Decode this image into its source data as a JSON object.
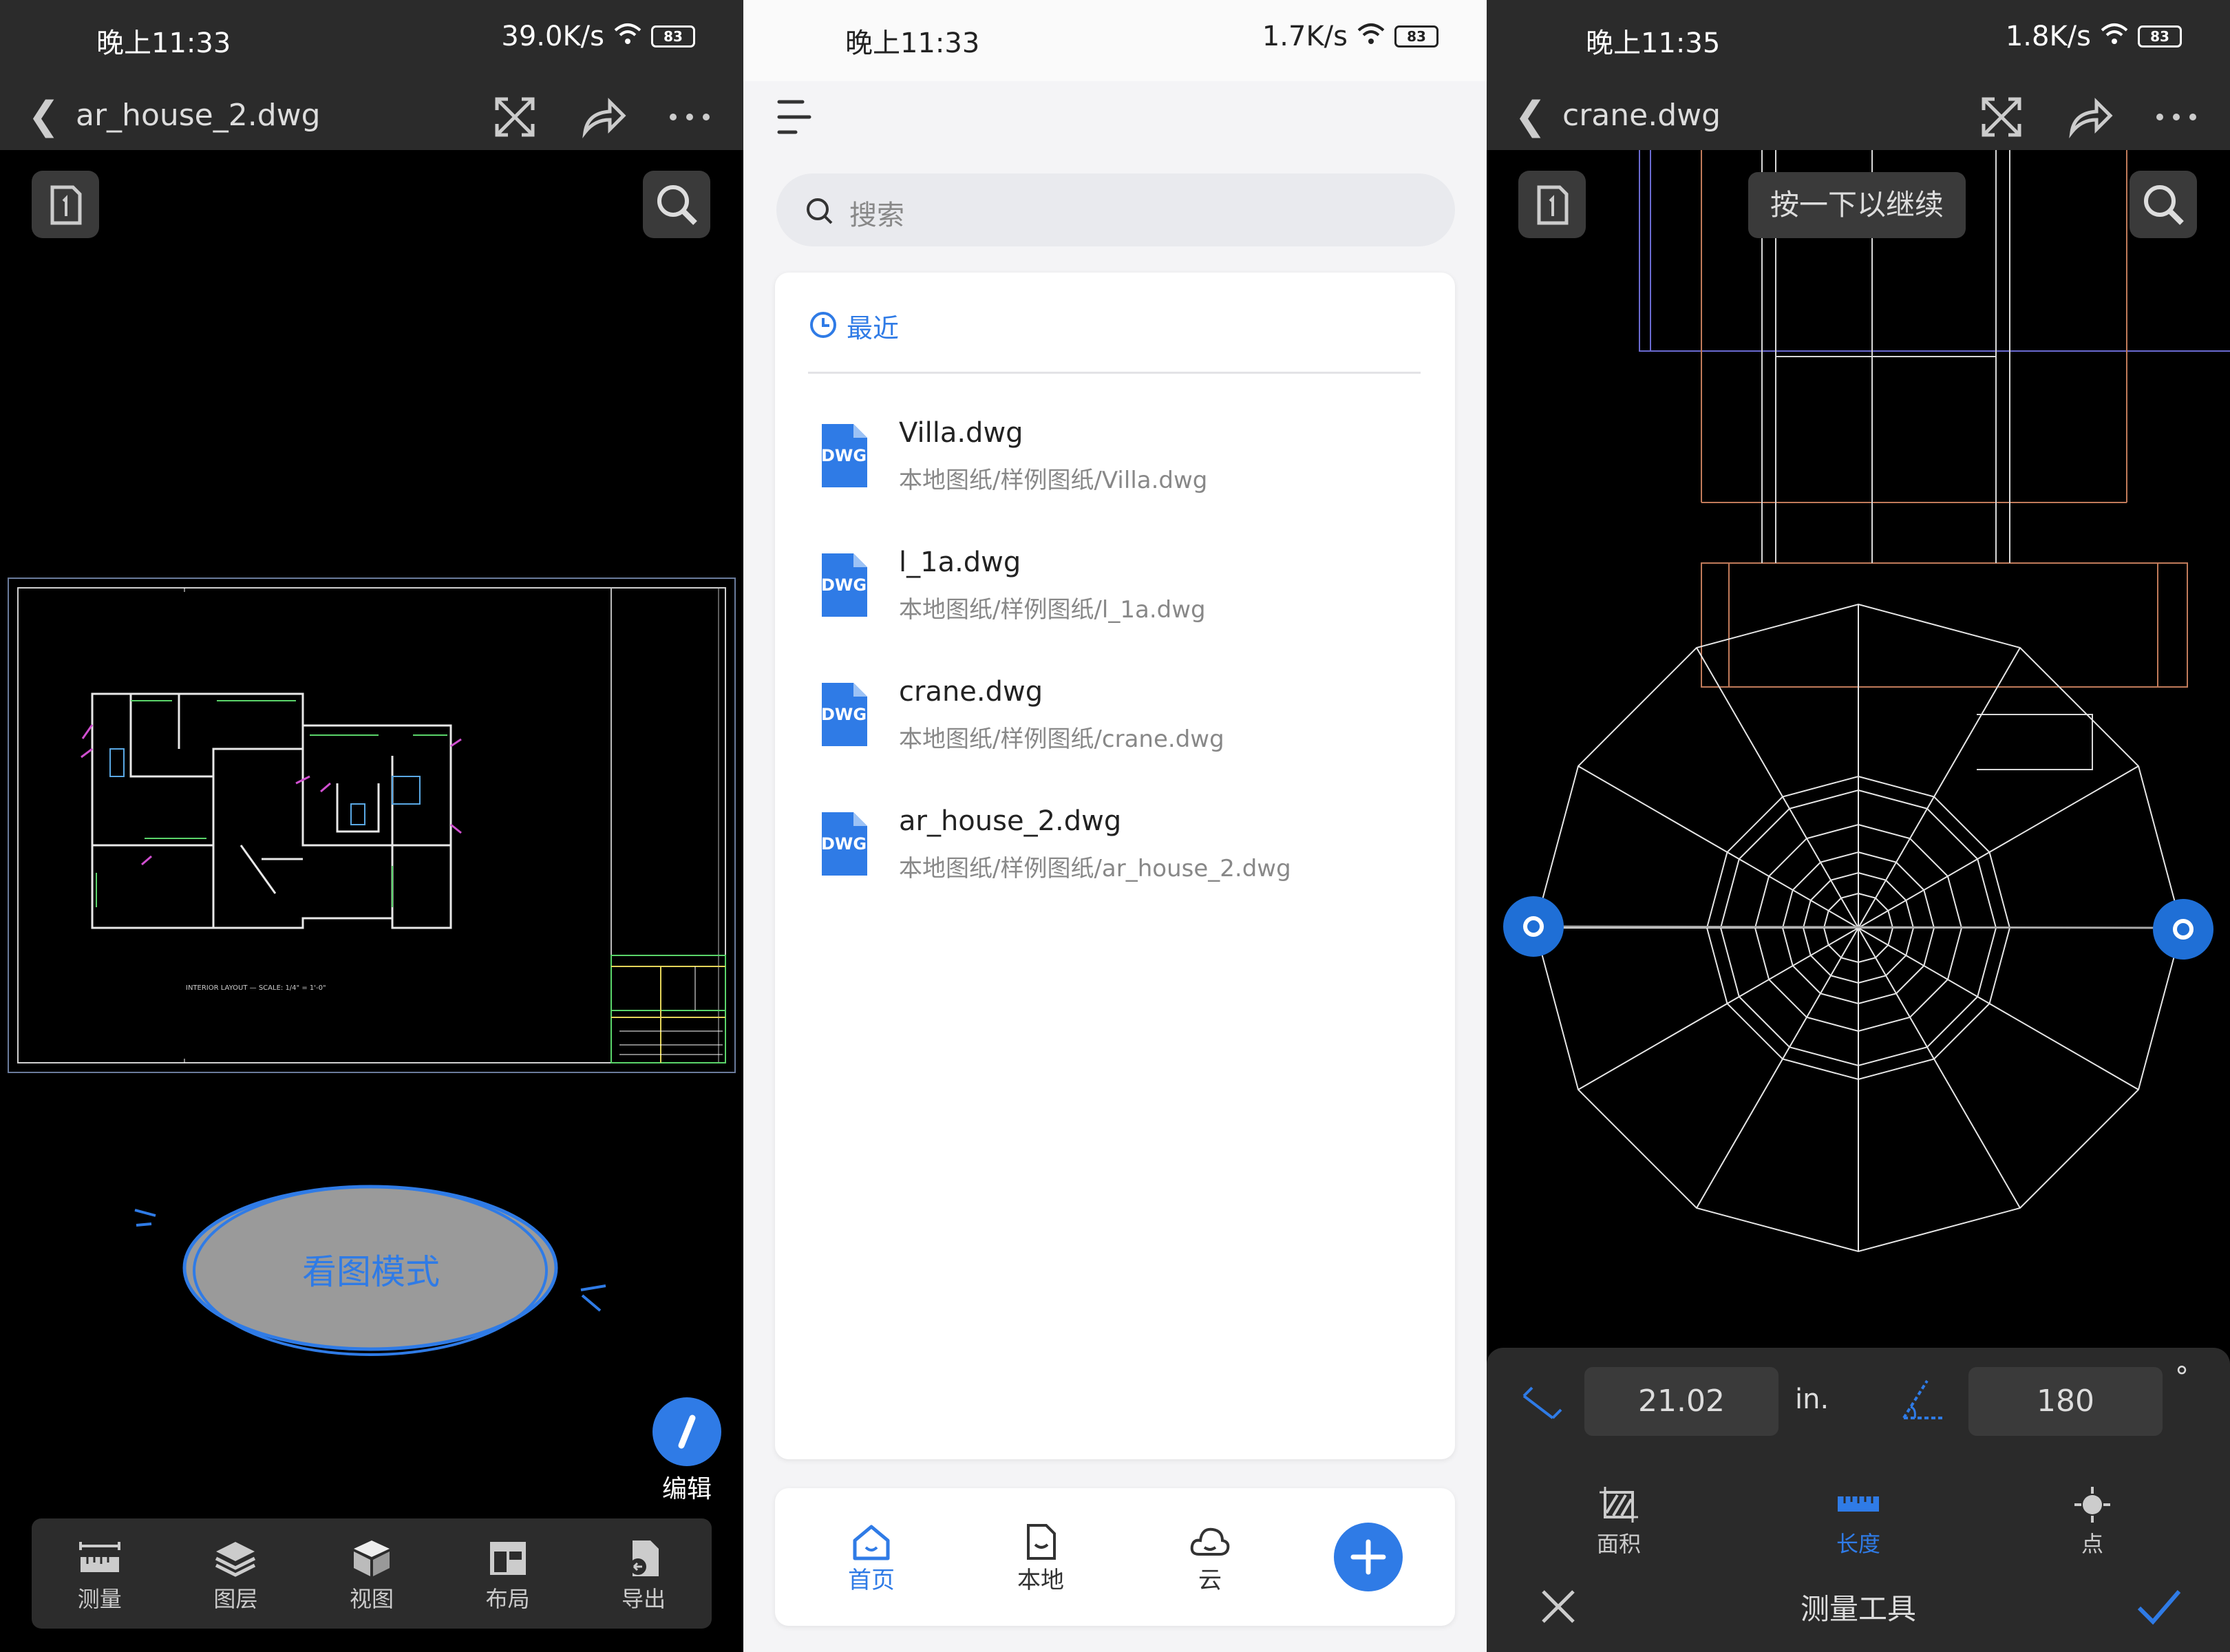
{
  "left": {
    "status": {
      "time": "晚上11:33",
      "speed": "39.0K/s",
      "battery": "83"
    },
    "title": {
      "filename": "ar_house_2.dwg"
    },
    "drawing": {
      "caption": "INTERIOR LAYOUT — SCALE: 1/4\" = 1'-0\""
    },
    "mode_label": "看图模式",
    "edit_label": "编辑",
    "toolbar": [
      "测量",
      "图层",
      "视图",
      "布局",
      "导出"
    ]
  },
  "middle": {
    "status": {
      "time": "晚上11:33",
      "speed": "1.7K/s",
      "battery": "83"
    },
    "search": {
      "placeholder": "搜索"
    },
    "recent_label": "最近",
    "file_badge": "DWG",
    "files": [
      {
        "name": "Villa.dwg",
        "path": "本地图纸/样例图纸/Villa.dwg"
      },
      {
        "name": "l_1a.dwg",
        "path": "本地图纸/样例图纸/l_1a.dwg"
      },
      {
        "name": "crane.dwg",
        "path": "本地图纸/样例图纸/crane.dwg"
      },
      {
        "name": "ar_house_2.dwg",
        "path": "本地图纸/样例图纸/ar_house_2.dwg"
      }
    ],
    "nav": [
      "首页",
      "本地",
      "云"
    ],
    "accent": "#2f7be6"
  },
  "right": {
    "status": {
      "time": "晚上11:35",
      "speed": "1.8K/s",
      "battery": "83"
    },
    "title": {
      "filename": "crane.dwg"
    },
    "toast": "按一下以继续",
    "measure": {
      "length": "21.02",
      "unit": "in.",
      "angle": "180",
      "degree": "°"
    },
    "tools": [
      "面积",
      "长度",
      "点"
    ],
    "panel_title": "测量工具"
  }
}
